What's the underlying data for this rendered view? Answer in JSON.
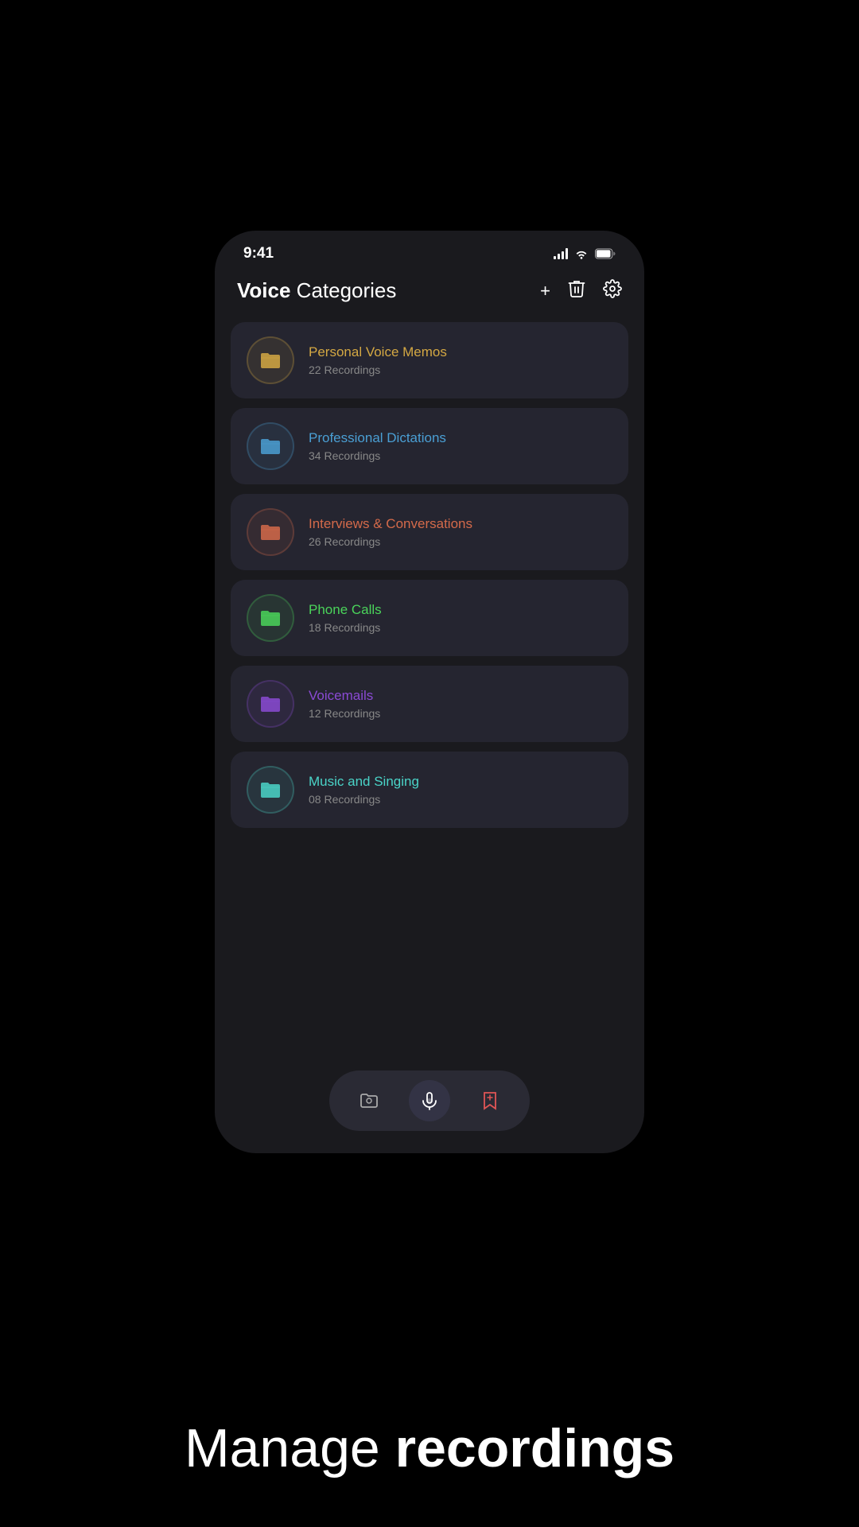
{
  "statusBar": {
    "time": "9:41"
  },
  "header": {
    "titleBold": "Voice",
    "titleLight": " Categories",
    "addLabel": "+",
    "deleteLabel": "🗑",
    "settingsLabel": "⚙"
  },
  "categories": [
    {
      "id": "personal-voice-memos",
      "name": "Personal Voice Memos",
      "count": "22 Recordings",
      "iconColor": "#d4a843",
      "borderColor": "#d4a843"
    },
    {
      "id": "professional-dictations",
      "name": "Professional Dictations",
      "count": "34 Recordings",
      "iconColor": "#4a9fd4",
      "borderColor": "#4a9fd4"
    },
    {
      "id": "interviews-conversations",
      "name": "Interviews & Conversations",
      "count": "26 Recordings",
      "iconColor": "#d46a4a",
      "borderColor": "#d46a4a"
    },
    {
      "id": "phone-calls",
      "name": "Phone Calls",
      "count": "18 Recordings",
      "iconColor": "#4ad45a",
      "borderColor": "#4ad45a"
    },
    {
      "id": "voicemails",
      "name": "Voicemails",
      "count": "12 Recordings",
      "iconColor": "#8a4ad4",
      "borderColor": "#8a4ad4"
    },
    {
      "id": "music-and-singing",
      "name": "Music and Singing",
      "count": "08 Recordings",
      "iconColor": "#4ad4c8",
      "borderColor": "#4ad4c8"
    }
  ],
  "tabBar": {
    "tabs": [
      {
        "id": "folders",
        "label": "Folders",
        "active": false
      },
      {
        "id": "record",
        "label": "Record",
        "active": true
      },
      {
        "id": "bookmarks",
        "label": "Bookmarks",
        "active": false
      }
    ]
  },
  "bottomText": {
    "light": "Manage ",
    "bold": "recordings"
  }
}
